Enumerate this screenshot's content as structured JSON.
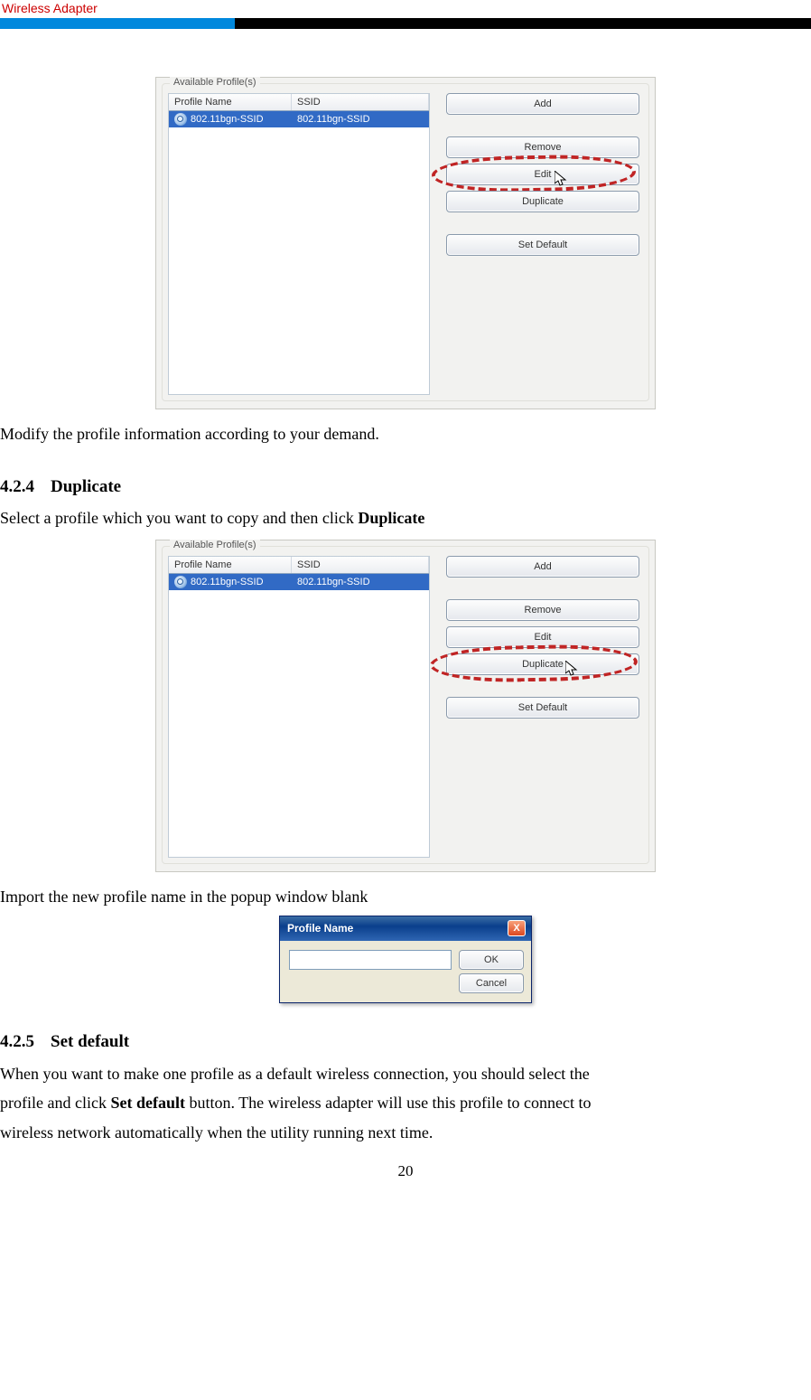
{
  "header": {
    "title": "Wireless Adapter"
  },
  "shot1": {
    "group_title": "Available Profile(s)",
    "cols": {
      "profile": "Profile Name",
      "ssid": "SSID"
    },
    "row": {
      "name": "802.11bgn-SSID",
      "ssid": "802.11bgn-SSID"
    },
    "buttons": {
      "add": "Add",
      "remove": "Remove",
      "edit": "Edit",
      "duplicate": "Duplicate",
      "set_default": "Set Default"
    }
  },
  "line_modify": "Modify the profile information according to your demand.",
  "sec_424": {
    "num": "4.2.4",
    "title": "Duplicate"
  },
  "line_select_dup1": "Select a profile which you want to copy and then click ",
  "line_select_dup_bold": "Duplicate",
  "shot2": {
    "group_title": "Available Profile(s)",
    "cols": {
      "profile": "Profile Name",
      "ssid": "SSID"
    },
    "row": {
      "name": "802.11bgn-SSID",
      "ssid": "802.11bgn-SSID"
    },
    "buttons": {
      "add": "Add",
      "remove": "Remove",
      "edit": "Edit",
      "duplicate": "Duplicate",
      "set_default": "Set Default"
    }
  },
  "line_import": "Import the new profile name in the popup window blank",
  "popup": {
    "title": "Profile Name",
    "ok": "OK",
    "cancel": "Cancel",
    "close": "X"
  },
  "sec_425": {
    "num": "4.2.5",
    "title": "Set default"
  },
  "para_default1": "When you want to make one profile as a default wireless connection, you should select the",
  "para_default2a": "profile and click ",
  "para_default2b": "Set default",
  "para_default2c": " button. The wireless adapter will use this profile to connect to",
  "para_default3": "wireless network automatically when the utility running next time.",
  "page_number": "20"
}
